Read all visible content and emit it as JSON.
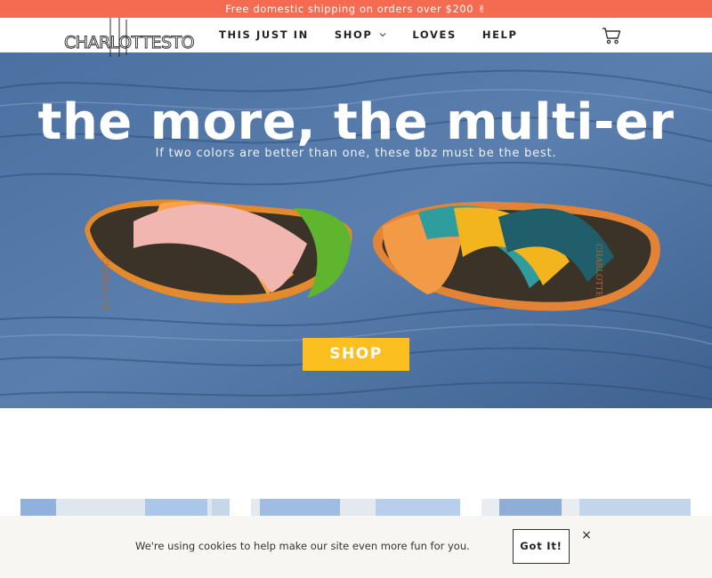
{
  "announcement": {
    "text": "Free domestic shipping on orders over $200 ✌"
  },
  "brand": {
    "logo_text": "CHARLOTTE STONE"
  },
  "nav": {
    "items": [
      {
        "label": "THIS JUST IN"
      },
      {
        "label": "SHOP"
      },
      {
        "label": "LOVES"
      },
      {
        "label": "HELP"
      }
    ]
  },
  "hero": {
    "title": "the more, the multi-er",
    "subtitle": "If two colors are better than one, these bbz must be the best.",
    "cta_label": "SHOP"
  },
  "cookie": {
    "message": "We're using cookies to help make our site even more fun for you.",
    "accept_label": "Got It!",
    "close_glyph": "×"
  },
  "colors": {
    "announcement_bg": "#f56b52",
    "cta_bg": "#fbbf1f",
    "hero_bg": "#4a6f9f",
    "cookie_bg": "#f8f6f3"
  },
  "icons": [
    "chevron-down-icon",
    "cart-icon",
    "close-icon"
  ]
}
